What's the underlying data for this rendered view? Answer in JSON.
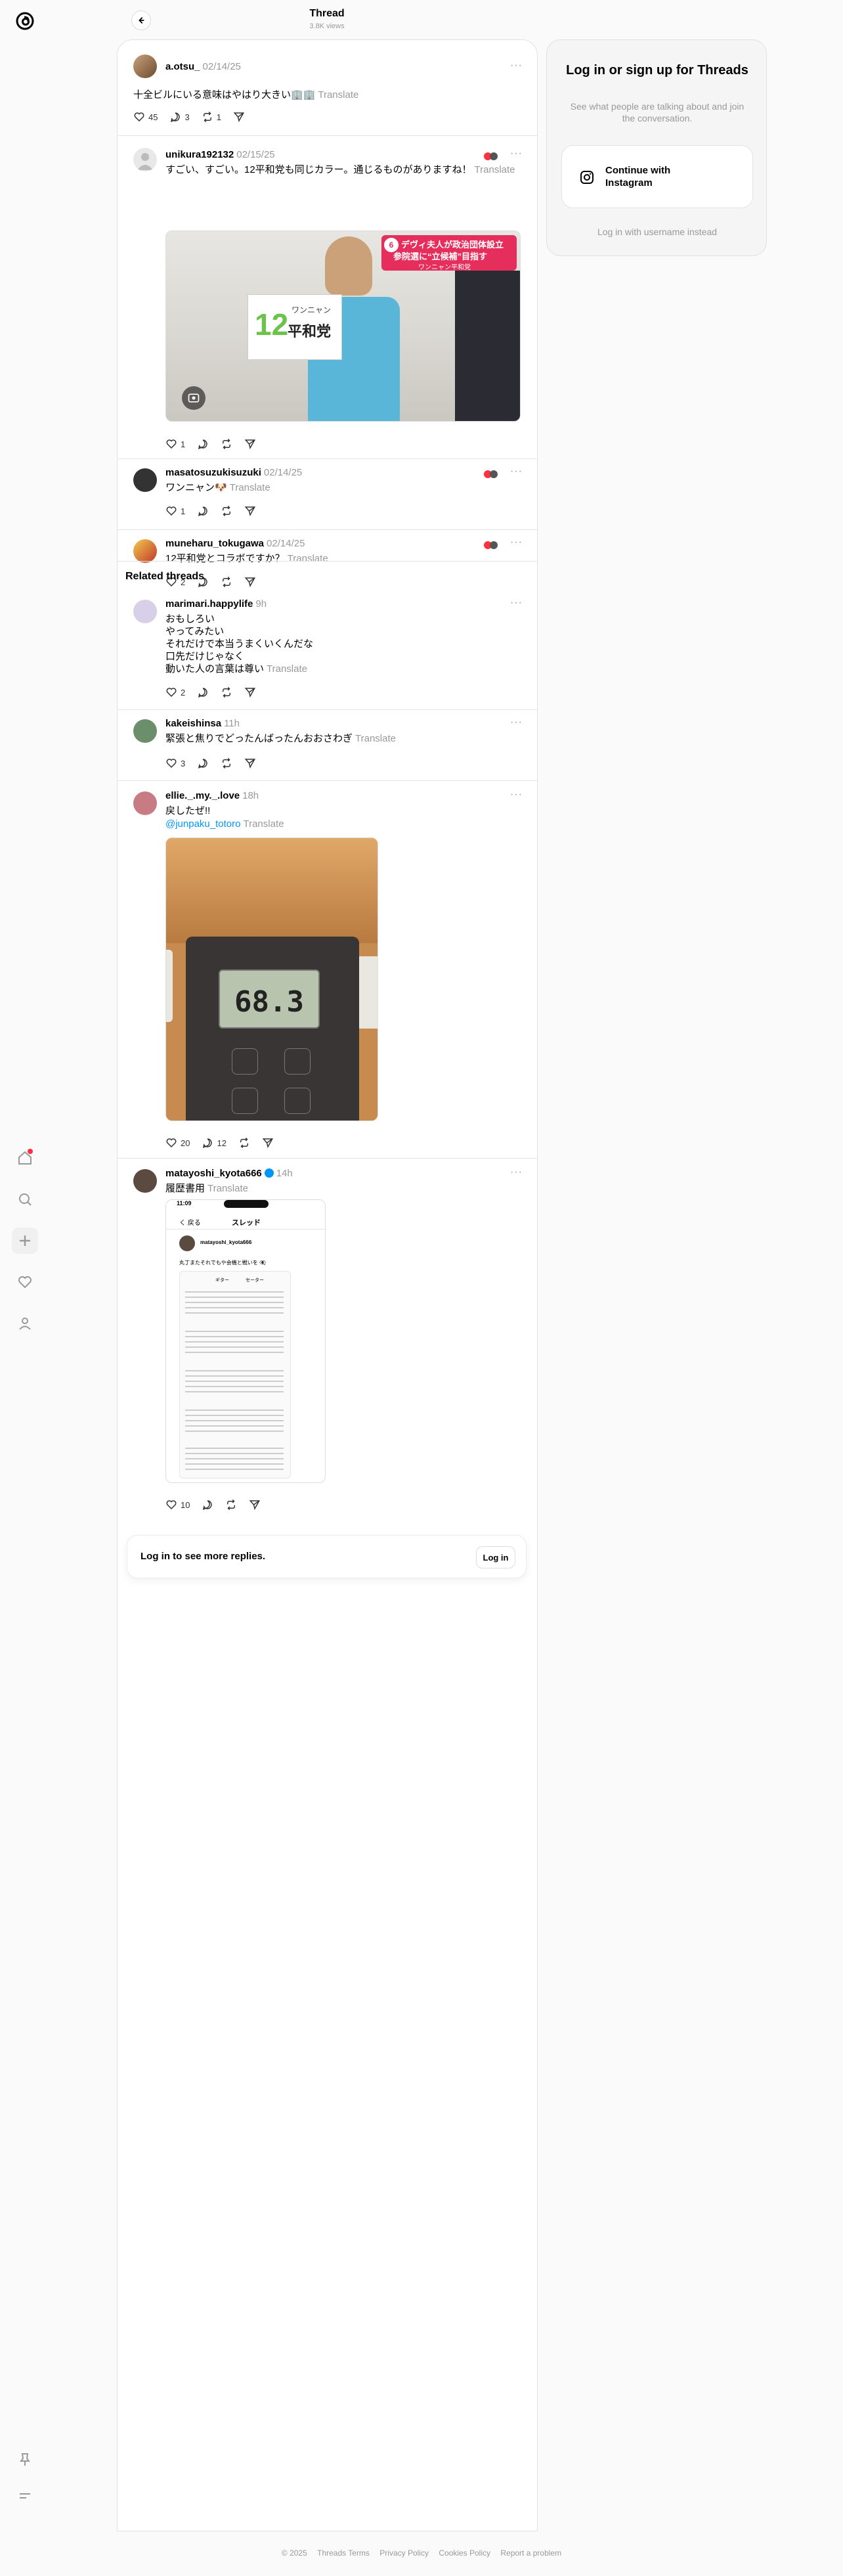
{
  "header": {
    "title": "Thread",
    "views": "3.8K views"
  },
  "main_post": {
    "username": "a.otsu_",
    "date": "02/14/25",
    "text": "十全ビルにいる意味はやはり大きい🏢🏢",
    "translate": "Translate",
    "likes": "45",
    "replies": "3",
    "reposts": "1"
  },
  "replies": [
    {
      "username": "unikura192132",
      "date": "02/15/25",
      "text": "すごい、すごい。12平和党も同じカラー。通じるものがありますね！",
      "translate": "Translate",
      "likes": "1",
      "image_caption_1": "デヴィ夫人が政治団体設立",
      "image_caption_2": "参院選に“立候補”目指す",
      "image_caption_3": "ワンニャン平和党",
      "image_sign_num": "12",
      "image_sign_1": "ワンニャン",
      "image_sign_2": "平和党",
      "image_badge": "6"
    },
    {
      "username": "masatosuzukisuzuki",
      "date": "02/14/25",
      "text": "ワンニャン🐶",
      "translate": "Translate",
      "likes": "1"
    },
    {
      "username": "muneharu_tokugawa",
      "date": "02/14/25",
      "text": "12平和党とコラボですか？",
      "translate": "Translate",
      "likes": "2"
    }
  ],
  "related_heading": "Related threads",
  "related": [
    {
      "username": "marimari.happylife",
      "date": "9h",
      "text": "おもしろい\nやってみたい\nそれだけで本当うまくいくんだな\n口先だけじゃなく\n動いた人の言葉は尊い",
      "translate": "Translate",
      "likes": "2"
    },
    {
      "username": "kakeishinsa",
      "date": "11h",
      "text": "緊張と焦りでどったんばったんおおさわぎ",
      "translate": "Translate",
      "likes": "3"
    },
    {
      "username": "ellie._.my._.love",
      "date": "18h",
      "text": "戻したぜ!!",
      "mention": "@junpaku_totoro",
      "translate": "Translate",
      "likes": "20",
      "replies": "12",
      "scale_reading": "68.3"
    },
    {
      "username": "matayoshi_kyota666",
      "date": "14h",
      "text": "履歴書用",
      "translate": "Translate",
      "likes": "10",
      "shot_time": "11:09",
      "shot_back": "く 戻る",
      "shot_title": "スレッド",
      "shot_user": "matayoshi_kyota666",
      "shot_text": "丸丁またそれでもや会機と戦いを 👁️‍🗨️",
      "shot_reply_1": "ギター",
      "shot_reply_2": "セーター"
    }
  ],
  "login_bar": {
    "text": "Log in to see more replies.",
    "button": "Log in"
  },
  "card": {
    "title": "Log in or sign up for Threads",
    "subtitle": "See what people are talking about and join the conversation.",
    "instagram_button": "Continue with Instagram",
    "username_link": "Log in with username instead"
  },
  "footer": {
    "copyright": "© 2025",
    "links": [
      "Threads Terms",
      "Privacy Policy",
      "Cookies Policy",
      "Report a problem"
    ]
  },
  "colors": {
    "accent": "#0095f6",
    "notification": "#ff3040",
    "muted": "#999999"
  },
  "icons": {
    "rail": [
      "threads-logo-icon",
      "home-icon",
      "search-icon",
      "plus-icon",
      "heart-icon",
      "profile-icon",
      "pin-icon",
      "menu-icon"
    ],
    "post_actions": [
      "like-icon",
      "reply-icon",
      "repost-icon",
      "share-icon"
    ]
  }
}
